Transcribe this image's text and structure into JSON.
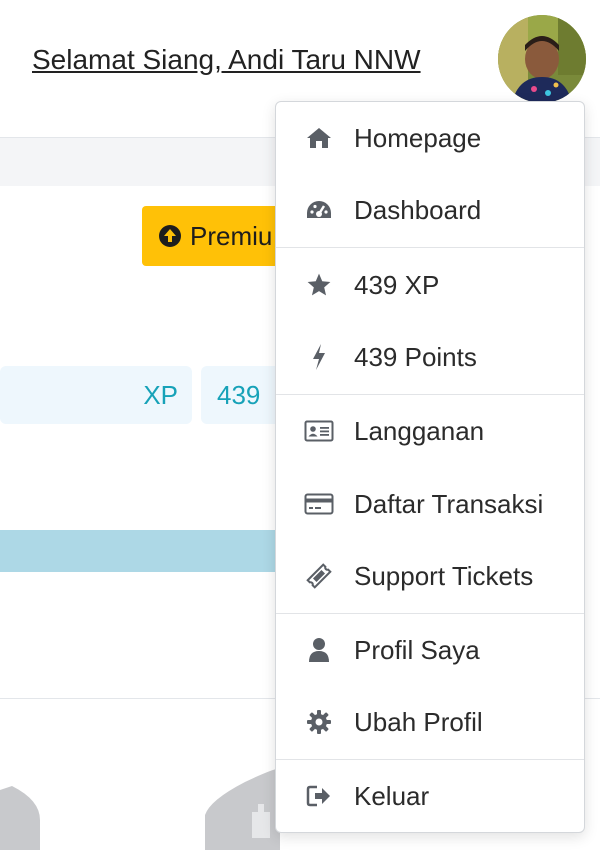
{
  "header": {
    "greeting": "Selamat Siang, Andi Taru NNW"
  },
  "main": {
    "premium_button": "Premiu",
    "stat_xp_label": "XP",
    "stat_xp_value": "439"
  },
  "dropdown": {
    "items": [
      {
        "label": "Homepage",
        "icon": "home-icon"
      },
      {
        "label": "Dashboard",
        "icon": "dashboard-icon"
      },
      {
        "label": "439 XP",
        "icon": "star-icon"
      },
      {
        "label": "439 Points",
        "icon": "bolt-icon"
      },
      {
        "label": "Langganan",
        "icon": "id-card-icon"
      },
      {
        "label": "Daftar Transaksi",
        "icon": "credit-card-icon"
      },
      {
        "label": "Support Tickets",
        "icon": "ticket-icon"
      },
      {
        "label": "Profil Saya",
        "icon": "user-icon"
      },
      {
        "label": "Ubah Profil",
        "icon": "gear-icon"
      },
      {
        "label": "Keluar",
        "icon": "sign-out-icon"
      }
    ]
  },
  "colors": {
    "premium": "#ffc107",
    "stat_text": "#17a2b8",
    "icon": "#5a5f66"
  }
}
